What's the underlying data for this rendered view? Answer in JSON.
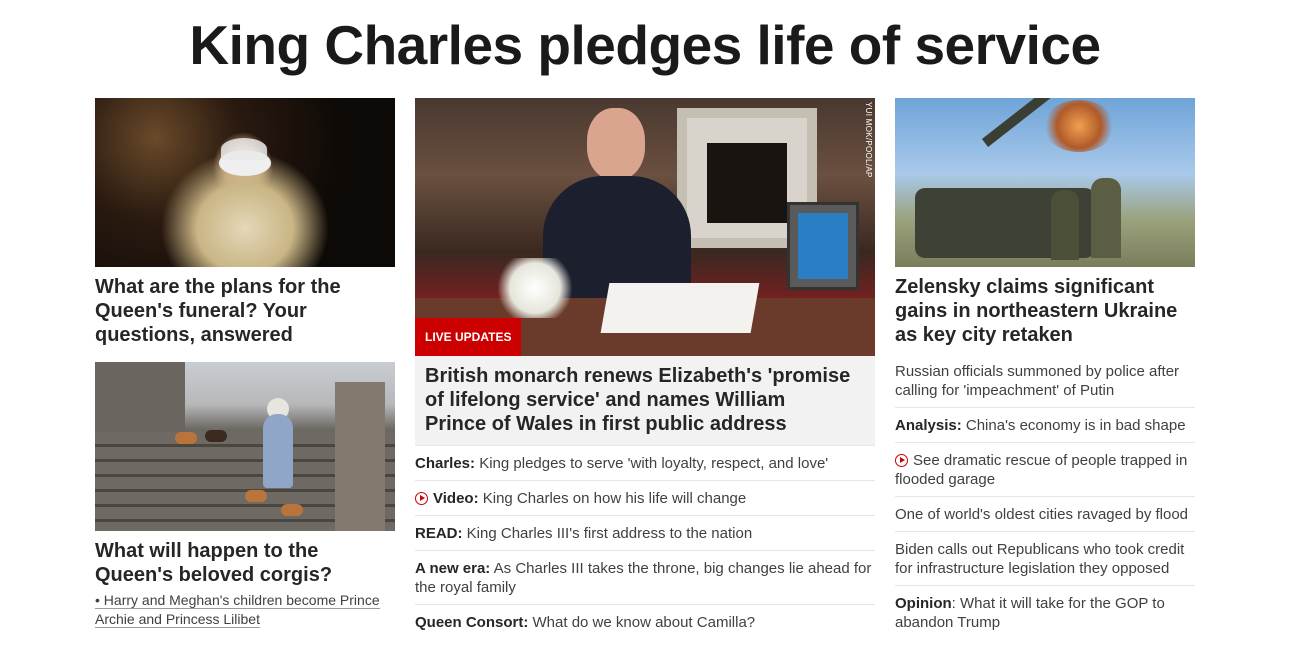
{
  "page": {
    "headline": "King Charles pledges life of service"
  },
  "left": {
    "story1": {
      "image_alt": "Queen Elizabeth wearing tiara",
      "headline_lines": [
        "What are the plans for the",
        "Queen's funeral? Your",
        "questions, answered"
      ]
    },
    "story2": {
      "image_alt": "Queen with corgis on castle steps",
      "headline_lines": [
        "What will happen to the",
        "Queen's beloved corgis?"
      ],
      "related_lines": [
        "• Harry and Meghan's children become Prince",
        "Archie and Princess Lilibet"
      ]
    }
  },
  "middle": {
    "image_alt": "King Charles at desk delivering address",
    "photo_credit": "YUI MOK/POOL/AP",
    "badge": "LIVE UPDATES",
    "headline_lines": [
      "British monarch renews Elizabeth's 'promise",
      "of lifelong service' and names William",
      "Prince of Wales in first public address"
    ],
    "links": [
      {
        "label": "Charles:",
        "text": " King pledges to serve 'with loyalty, respect, and love'",
        "video": false
      },
      {
        "label": "Video:",
        "text": " King Charles on how his life will change",
        "video": true
      },
      {
        "label": "READ:",
        "text": " King Charles III's first address to the nation",
        "video": false
      },
      {
        "label": "A new era:",
        "text": " As Charles III takes the throne, big changes lie ahead for the royal family",
        "video": false
      },
      {
        "label": "Queen Consort:",
        "text": " What do we know about Camilla?",
        "video": false
      }
    ]
  },
  "right": {
    "image_alt": "Ukrainian artillery firing",
    "headline_lines": [
      "Zelensky claims significant",
      "gains in northeastern Ukraine",
      "as key city retaken"
    ],
    "links": [
      {
        "label": "",
        "text": "Russian officials summoned by police after calling for 'impeachment' of Putin",
        "video": false
      },
      {
        "label": "Analysis:",
        "text": " China's economy is in bad shape",
        "video": false
      },
      {
        "label": "",
        "text": "See dramatic rescue of people trapped in flooded garage",
        "video": true
      },
      {
        "label": "",
        "text": "One of world's oldest cities ravaged by flood",
        "video": false
      },
      {
        "label": "",
        "text": "Biden calls out Republicans who took credit for infrastructure legislation they opposed",
        "video": false
      },
      {
        "label": "Opinion",
        "text": ": What it will take for the GOP to abandon Trump",
        "video": false
      }
    ]
  },
  "colors": {
    "accent_red": "#cc0000",
    "text_dark": "#262626",
    "text_body": "#404040"
  }
}
